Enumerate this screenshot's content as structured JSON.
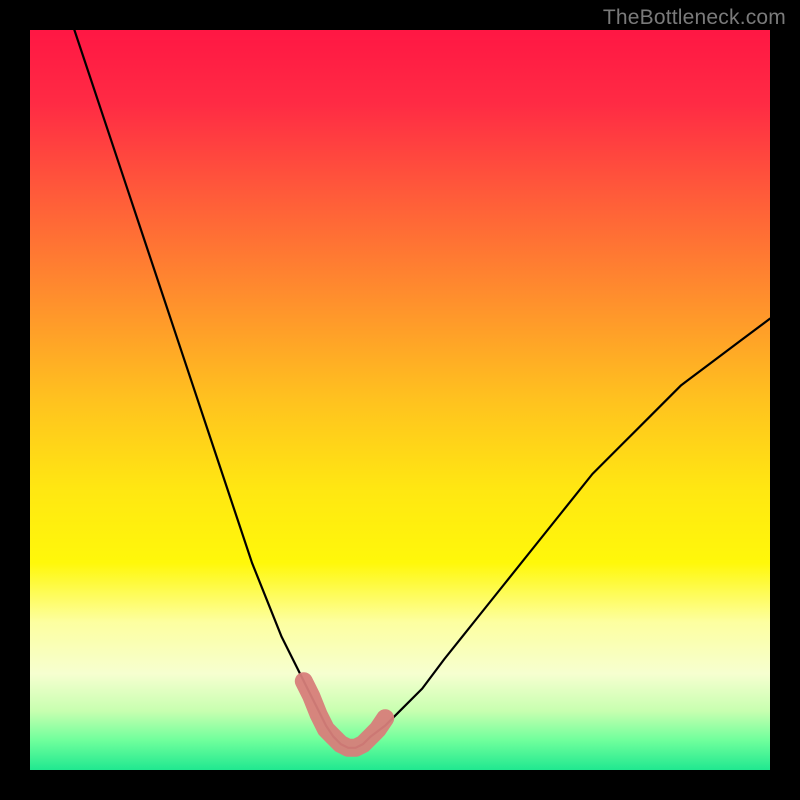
{
  "watermark": {
    "text": "TheBottleneck.com"
  },
  "colors": {
    "frame": "#000000",
    "curve": "#000000",
    "marker": "#d77e7a",
    "gradient_stops": [
      {
        "offset": 0.0,
        "color": "#ff1744"
      },
      {
        "offset": 0.1,
        "color": "#ff2b44"
      },
      {
        "offset": 0.22,
        "color": "#ff5a3a"
      },
      {
        "offset": 0.35,
        "color": "#ff8a2e"
      },
      {
        "offset": 0.5,
        "color": "#ffc21f"
      },
      {
        "offset": 0.62,
        "color": "#ffe712"
      },
      {
        "offset": 0.72,
        "color": "#fff80a"
      },
      {
        "offset": 0.8,
        "color": "#fdffa0"
      },
      {
        "offset": 0.87,
        "color": "#f6ffd0"
      },
      {
        "offset": 0.92,
        "color": "#c8ffb0"
      },
      {
        "offset": 0.96,
        "color": "#6fff9c"
      },
      {
        "offset": 1.0,
        "color": "#20e890"
      }
    ]
  },
  "chart_data": {
    "type": "line",
    "title": "",
    "xlabel": "",
    "ylabel": "",
    "xlim": [
      0,
      100
    ],
    "ylim": [
      0,
      100
    ],
    "grid": false,
    "legend": false,
    "series": [
      {
        "name": "bottleneck-curve",
        "x": [
          6,
          8,
          10,
          12,
          14,
          16,
          18,
          20,
          22,
          24,
          26,
          28,
          30,
          32,
          34,
          36,
          38,
          39,
          40,
          41,
          42,
          43,
          44,
          45,
          46,
          48,
          50,
          53,
          56,
          60,
          64,
          68,
          72,
          76,
          80,
          84,
          88,
          92,
          96,
          100
        ],
        "y": [
          100,
          94,
          88,
          82,
          76,
          70,
          64,
          58,
          52,
          46,
          40,
          34,
          28,
          23,
          18,
          14,
          10,
          8,
          6,
          4.5,
          3.5,
          3,
          3,
          3.5,
          4.5,
          6,
          8,
          11,
          15,
          20,
          25,
          30,
          35,
          40,
          44,
          48,
          52,
          55,
          58,
          61
        ]
      }
    ],
    "markers": {
      "name": "highlighted-range",
      "x": [
        37,
        38,
        39,
        40,
        41,
        42,
        43,
        44,
        45,
        46,
        47,
        48
      ],
      "y": [
        12,
        10,
        7.5,
        5.5,
        4.5,
        3.5,
        3,
        3,
        3.5,
        4.5,
        5.5,
        7
      ]
    }
  }
}
